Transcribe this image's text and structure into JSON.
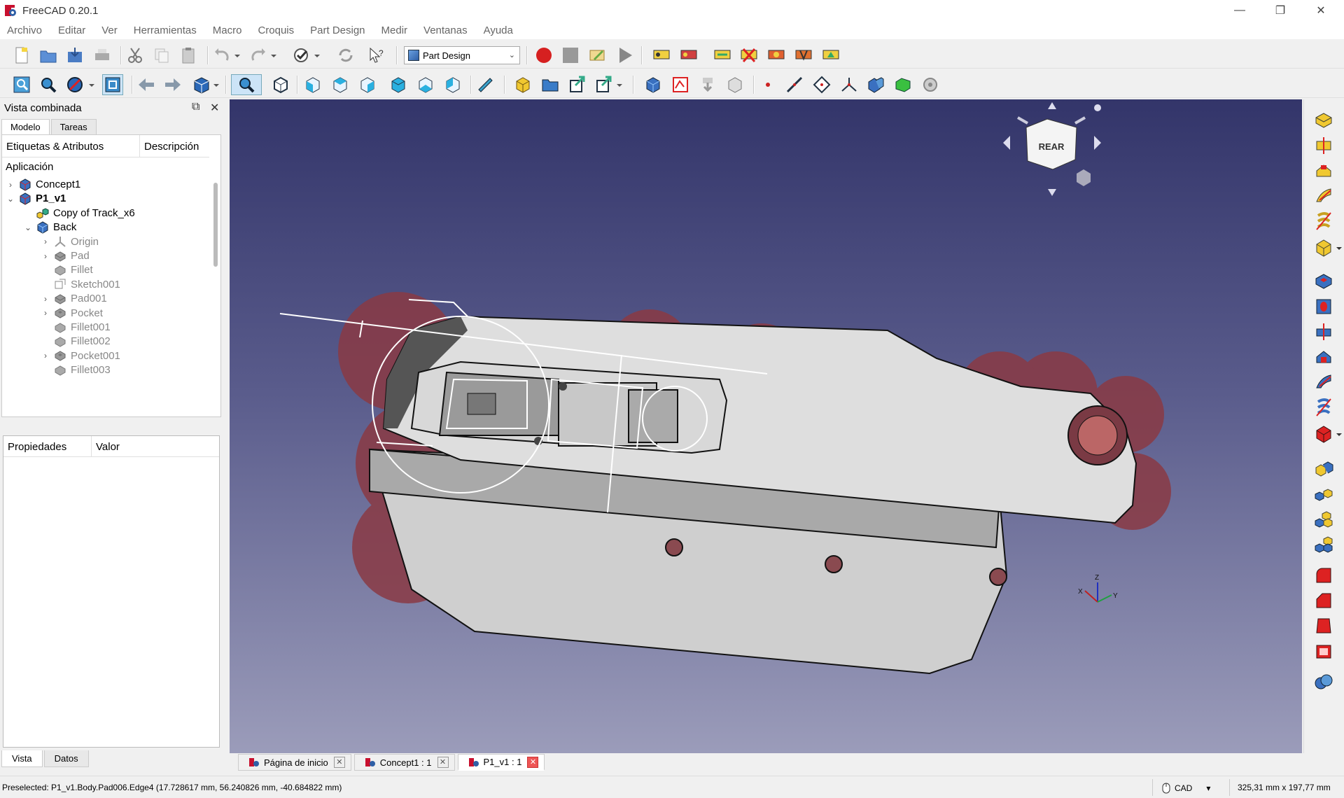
{
  "window": {
    "title": "FreeCAD 0.20.1",
    "controls": {
      "minimize": "—",
      "restore": "❐",
      "close": "✕"
    }
  },
  "menu": [
    "Archivo",
    "Editar",
    "Ver",
    "Herramientas",
    "Macro",
    "Croquis",
    "Part Design",
    "Medir",
    "Ventanas",
    "Ayuda"
  ],
  "toolbar": {
    "workbench": "Part Design"
  },
  "combo_view": {
    "title": "Vista combinada",
    "tabs": [
      "Modelo",
      "Tareas"
    ],
    "tree_headers": [
      "Etiquetas & Atributos",
      "Descripción"
    ],
    "section": "Aplicación",
    "items": [
      {
        "label": "Concept1",
        "expander": "›",
        "icon": "part-icon"
      },
      {
        "label": "P1_v1",
        "expander": "⌄",
        "icon": "part-icon"
      },
      {
        "label": "Copy of Track_x6",
        "expander": "",
        "icon": "pattern-icon"
      },
      {
        "label": "Back",
        "expander": "⌄",
        "icon": "body-icon"
      },
      {
        "label": "Origin",
        "expander": "›",
        "icon": "origin-icon"
      },
      {
        "label": "Pad",
        "expander": "›",
        "icon": "pad-icon"
      },
      {
        "label": "Fillet",
        "expander": "",
        "icon": "fillet-icon"
      },
      {
        "label": "Sketch001",
        "expander": "",
        "icon": "sketch-icon"
      },
      {
        "label": "Pad001",
        "expander": "›",
        "icon": "pad-icon"
      },
      {
        "label": "Pocket",
        "expander": "›",
        "icon": "pocket-icon"
      },
      {
        "label": "Fillet001",
        "expander": "",
        "icon": "fillet-icon"
      },
      {
        "label": "Fillet002",
        "expander": "",
        "icon": "fillet-icon"
      },
      {
        "label": "Pocket001",
        "expander": "›",
        "icon": "pocket-icon"
      },
      {
        "label": "Fillet003",
        "expander": "",
        "icon": "fillet-icon"
      }
    ],
    "prop_headers": [
      "Propiedades",
      "Valor"
    ],
    "bottom_tabs": [
      "Vista",
      "Datos"
    ]
  },
  "navcube": {
    "face": "REAR"
  },
  "axes": {
    "z": "Z",
    "x": "X",
    "y": "Y"
  },
  "doc_tabs": [
    {
      "label": "Página de inicio",
      "close": "✕"
    },
    {
      "label": "Concept1 : 1",
      "close": "✕"
    },
    {
      "label": "P1_v1 : 1",
      "close": "✕"
    }
  ],
  "status": {
    "message": "Preselected: P1_v1.Body.Pad006.Edge4 (17.728617 mm, 56.240826 mm, -40.684822 mm)",
    "nav_style": "CAD",
    "dimensions": "325,31 mm x 197,77 mm"
  },
  "colors": {
    "viewport_top": "#33356a",
    "viewport_bottom": "#9b9cba",
    "model_body": "#d8d8d8",
    "track_wheels": "#8a3a44",
    "record_button": "#d62020"
  }
}
